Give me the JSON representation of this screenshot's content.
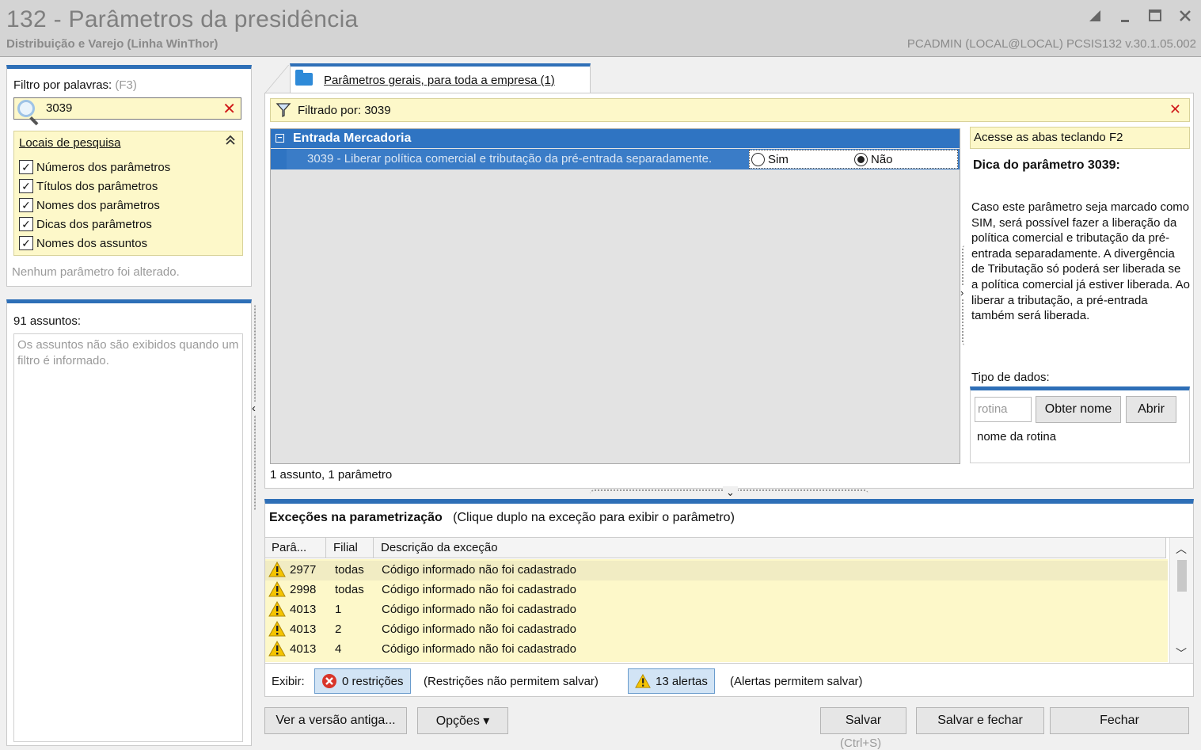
{
  "window": {
    "title": "132 - Parâmetros da presidência",
    "subtitle": "Distribuição e Varejo (Linha WinThor)",
    "userinfo": "PCADMIN (LOCAL@LOCAL)   PCSIS132  v.30.1.05.002"
  },
  "search": {
    "label": "Filtro por palavras:",
    "shortcut": "(F3)",
    "value": "3039",
    "locais_header": "Locais de pesquisa",
    "options": [
      {
        "label": "Números dos parâmetros",
        "checked": true
      },
      {
        "label": "Títulos dos parâmetros",
        "checked": true
      },
      {
        "label": "Nomes dos parâmetros",
        "checked": true
      },
      {
        "label": "Dicas dos parâmetros",
        "checked": true
      },
      {
        "label": "Nomes dos assuntos",
        "checked": true
      }
    ],
    "status": "Nenhum parâmetro foi alterado."
  },
  "assuntos": {
    "header": "91 assuntos:",
    "message": "Os assuntos não são exibidos quando um filtro é informado."
  },
  "tab": {
    "label": "Parâmetros gerais, para toda a empresa  (1)"
  },
  "filter": {
    "text": "Filtrado por: 3039"
  },
  "grid": {
    "group": "Entrada Mercadoria",
    "row_text": "3039 - Liberar política comercial e tributação da pré-entrada separadamente.",
    "option_sim": "Sim",
    "option_nao": "Não",
    "selected": "Não",
    "count": "1 assunto, 1 parâmetro"
  },
  "hint": {
    "tip": "Acesse as abas teclando F2",
    "title": "Dica do parâmetro 3039:",
    "body": "Caso este parâmetro seja marcado como SIM, será possível fazer a liberação da política comercial e tributação da pré-entrada separadamente. A divergência de Tributação só poderá ser liberada se a política comercial já estiver liberada. Ao liberar a tributação, a pré-entrada também será liberada.",
    "tipo_label": "Tipo de dados:",
    "rotina_placeholder": "rotina",
    "btn_obter": "Obter nome",
    "btn_abrir": "Abrir",
    "rotina_nome": "nome da rotina"
  },
  "excecoes": {
    "title": "Exceções na parametrização",
    "subtitle": "(Clique duplo na exceção para exibir o parâmetro)",
    "columns": [
      "Parâ...",
      "Filial",
      "Descrição da exceção"
    ],
    "rows": [
      {
        "param": "2977",
        "filial": "todas",
        "desc": "Código informado não foi cadastrado"
      },
      {
        "param": "2998",
        "filial": "todas",
        "desc": "Código informado não foi cadastrado"
      },
      {
        "param": "4013",
        "filial": "1",
        "desc": "Código informado não foi cadastrado"
      },
      {
        "param": "4013",
        "filial": "2",
        "desc": "Código informado não foi cadastrado"
      },
      {
        "param": "4013",
        "filial": "4",
        "desc": "Código informado não foi cadastrado"
      }
    ],
    "exibir_label": "Exibir:",
    "restricoes": "0 restrições",
    "restricoes_note": "(Restrições não permitem salvar)",
    "alertas": "13 alertas",
    "alertas_note": "(Alertas permitem salvar)"
  },
  "footer": {
    "ver_antiga": "Ver a versão antiga...",
    "opcoes": "Opções ▾",
    "salvar": "Salvar",
    "salvar_fechar": "Salvar e fechar",
    "fechar": "Fechar",
    "salvar_shortcut": "(Ctrl+S)"
  },
  "colors": {
    "accent": "#2e6fb7",
    "highlight_yellow": "#fdf8c9",
    "error_red": "#d01a1a"
  }
}
